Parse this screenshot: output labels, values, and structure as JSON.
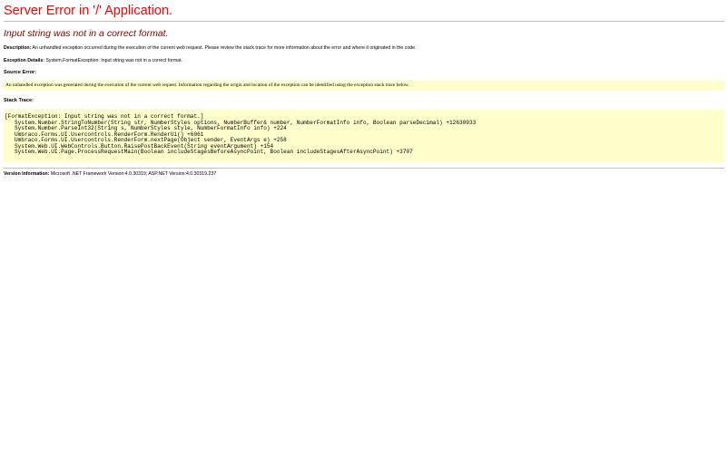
{
  "page": {
    "title": "Server Error in '/' Application.",
    "subtitle": "Input string was not in a correct format."
  },
  "description": {
    "label": "Description:",
    "text": "An unhandled exception occurred during the execution of the current web request. Please review the stack trace for more information about the error and where it originated in the code."
  },
  "exception_details": {
    "label": "Exception Details:",
    "text": "System.FormatException: Input string was not in a correct format."
  },
  "source_error": {
    "label": "Source Error:",
    "text": "An unhandled exception was generated during the execution of the current web request. Information regarding the origin and location of the exception can be identified using the exception stack trace below."
  },
  "stack_trace": {
    "label": "Stack Trace:",
    "lines": [
      "[FormatException: Input string was not in a correct format.]",
      "   System.Number.StringToNumber(String str, NumberStyles options, NumberBuffer& number, NumberFormatInfo info, Boolean parseDecimal) +12630933",
      "   System.Number.ParseInt32(String s, NumberStyles style, NumberFormatInfo info) +224",
      "   Umbraco.Forms.UI.Usercontrols.RenderForm.RenderUi() +6061",
      "   Umbraco.Forms.UI.Usercontrols.RenderForm.nextPage(Object sender, EventArgs e) +258",
      "   System.Web.UI.WebControls.Button.RaisePostBackEvent(String eventArgument) +154",
      "   System.Web.UI.Page.ProcessRequestMain(Boolean includeStagesBeforeAsyncPoint, Boolean includeStagesAfterAsyncPoint) +3707"
    ]
  },
  "version_info": {
    "label": "Version Information:",
    "text": "Microsoft .NET Framework Version:4.0.30319; ASP.NET Version:4.0.30319.237"
  },
  "colors": {
    "title": "#ff0000",
    "subtitle": "#800000",
    "code_background": "#ffffcc",
    "rule": "#c0c0c0"
  }
}
